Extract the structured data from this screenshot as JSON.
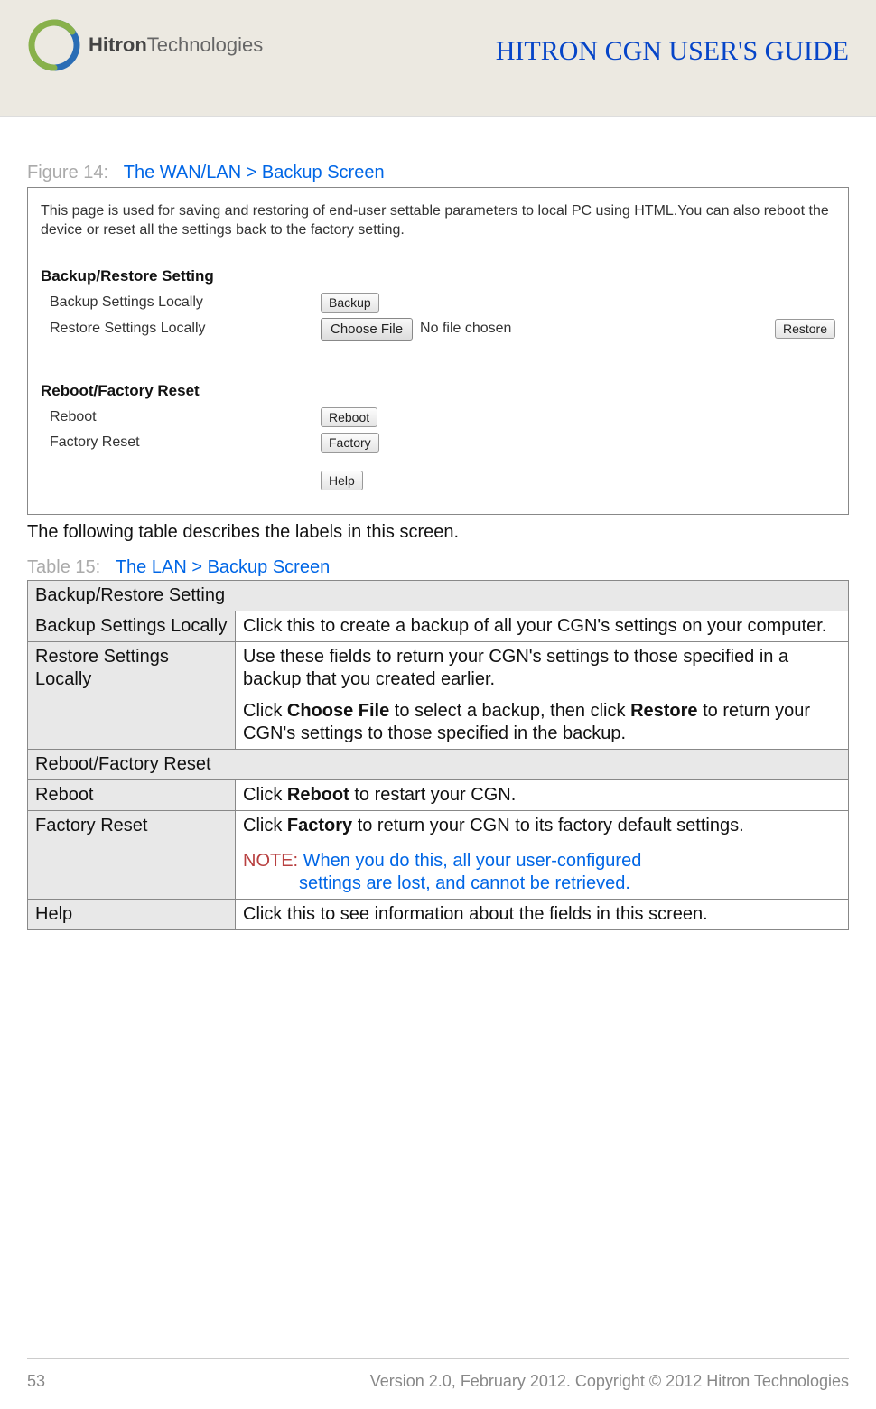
{
  "header": {
    "logo_prefix": "Hitron",
    "logo_suffix": "Technologies",
    "doc_title": "HITRON CGN USER'S GUIDE"
  },
  "figure": {
    "number": "Figure 14:",
    "title": "The WAN/LAN > Backup Screen"
  },
  "screenshot": {
    "intro": "This page is used for saving and restoring of end-user settable parameters to local PC using HTML.You can also reboot the device or reset all the settings back to the factory setting.",
    "section1": "Backup/Restore Setting",
    "backup_label": "Backup Settings Locally",
    "backup_btn": "Backup",
    "restore_label": "Restore Settings Locally",
    "choose_file_btn": "Choose File",
    "file_status": "No file chosen",
    "restore_btn": "Restore",
    "section2": "Reboot/Factory Reset",
    "reboot_label": "Reboot",
    "reboot_btn": "Reboot",
    "factory_label": "Factory Reset",
    "factory_btn": "Factory",
    "help_btn": "Help"
  },
  "body_text": "The following table describes the labels in this screen.",
  "table_caption": {
    "number": "Table 15:",
    "title": "The LAN > Backup Screen"
  },
  "table": {
    "sec1": "Backup/Restore Setting",
    "r1_label": "Backup Settings Locally",
    "r1_desc": "Click this to create a backup of all your CGN's settings on your computer.",
    "r2_label": "Restore Settings Locally",
    "r2_desc_p1": "Use these fields to return your CGN's settings to those specified in a backup that you created earlier.",
    "r2_desc_p2a": "Click ",
    "r2_desc_p2b": "Choose File",
    "r2_desc_p2c": " to select a backup, then click ",
    "r2_desc_p2d": "Restore",
    "r2_desc_p2e": " to return your CGN's settings to those specified in the backup.",
    "sec2": "Reboot/Factory Reset",
    "r3_label": "Reboot",
    "r3_desc_a": "Click ",
    "r3_desc_b": "Reboot",
    "r3_desc_c": " to restart your CGN.",
    "r4_label": "Factory Reset",
    "r4_desc_a": "Click ",
    "r4_desc_b": "Factory",
    "r4_desc_c": " to return your CGN to its factory default settings.",
    "r4_note_label": "NOTE:",
    "r4_note_line1": " When you do this, all your user-configured",
    "r4_note_line2": "settings are lost, and cannot be retrieved.",
    "r5_label": "Help",
    "r5_desc": "Click this to see information about the fields in this screen."
  },
  "footer": {
    "page": "53",
    "copyright": "Version 2.0, February 2012. Copyright © 2012 Hitron Technologies"
  }
}
